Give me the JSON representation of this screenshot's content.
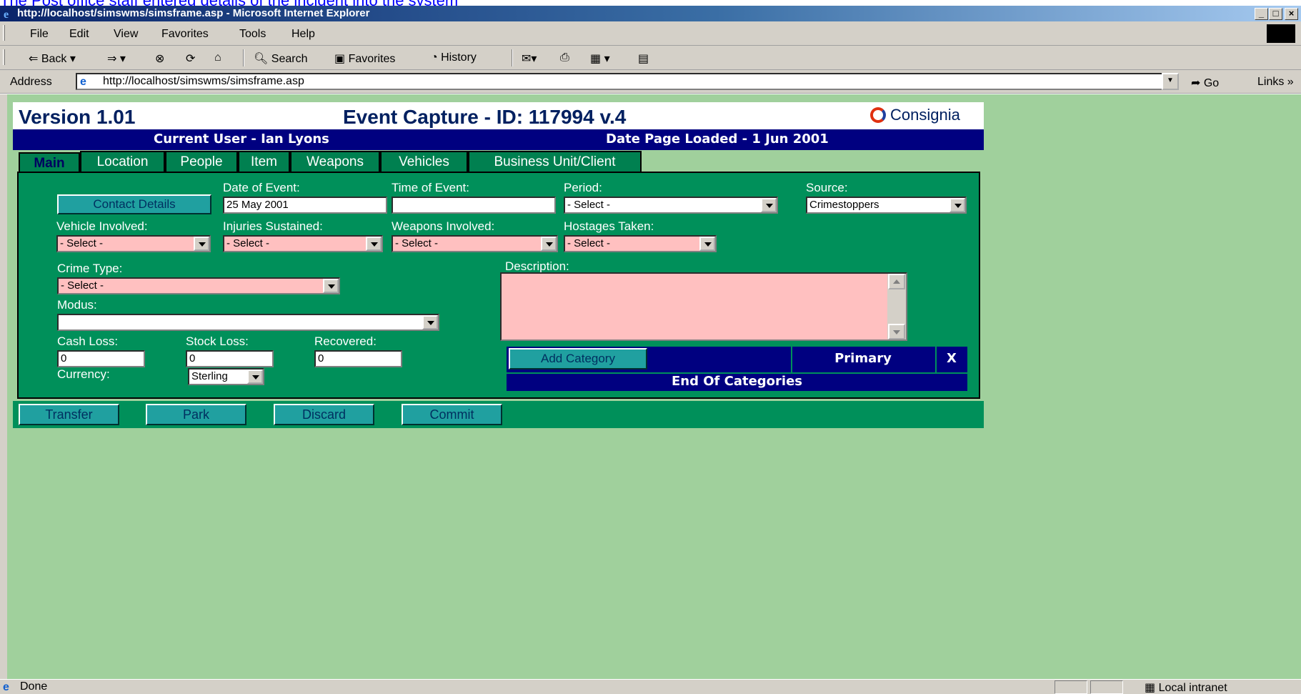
{
  "caption": "The Post office staff entered details of the incident into the system",
  "window": {
    "title": "http://localhost/simswms/simsframe.asp - Microsoft Internet Explorer",
    "min": "_",
    "max": "□",
    "close": "×"
  },
  "menu": [
    "File",
    "Edit",
    "View",
    "Favorites",
    "Tools",
    "Help"
  ],
  "toolbar": {
    "back": "Back",
    "search": "Search",
    "favorites": "Favorites",
    "history": "History"
  },
  "address": {
    "label": "Address",
    "url": "http://localhost/simswms/simsframe.asp",
    "go": "Go",
    "links": "Links"
  },
  "app": {
    "version": "Version 1.01",
    "title": "Event Capture - ID: 117994  v.4",
    "brand": "Consignia",
    "current_user": "Current User - Ian Lyons",
    "date_loaded": "Date Page Loaded - 1 Jun 2001"
  },
  "tabs": [
    "Main",
    "Location",
    "People",
    "Item",
    "Weapons",
    "Vehicles",
    "Business Unit/Client"
  ],
  "form": {
    "contact_details": "Contact Details",
    "date_of_event_label": "Date of Event:",
    "date_of_event": "25 May 2001",
    "time_of_event_label": "Time of Event:",
    "time_of_event": "",
    "period_label": "Period:",
    "period": "- Select -",
    "source_label": "Source:",
    "source": "Crimestoppers",
    "vehicle_label": "Vehicle Involved:",
    "vehicle": "- Select -",
    "injuries_label": "Injuries Sustained:",
    "injuries": "- Select -",
    "weapons_label": "Weapons Involved:",
    "weapons": "- Select -",
    "hostages_label": "Hostages Taken:",
    "hostages": "- Select -",
    "crime_type_label": "Crime Type:",
    "crime_type": "- Select -",
    "modus_label": "Modus:",
    "modus": "",
    "description_label": "Description:",
    "cash_loss_label": "Cash Loss:",
    "cash_loss": "0",
    "stock_loss_label": "Stock Loss:",
    "stock_loss": "0",
    "recovered_label": "Recovered:",
    "recovered": "0",
    "currency_label": "Currency:",
    "currency": "Sterling"
  },
  "categories": {
    "add": "Add Category",
    "primary": "Primary",
    "remove": "X",
    "end": "End Of Categories"
  },
  "actions": [
    "Transfer",
    "Park",
    "Discard",
    "Commit"
  ],
  "status": {
    "text": "Done",
    "zone": "Local intranet"
  }
}
